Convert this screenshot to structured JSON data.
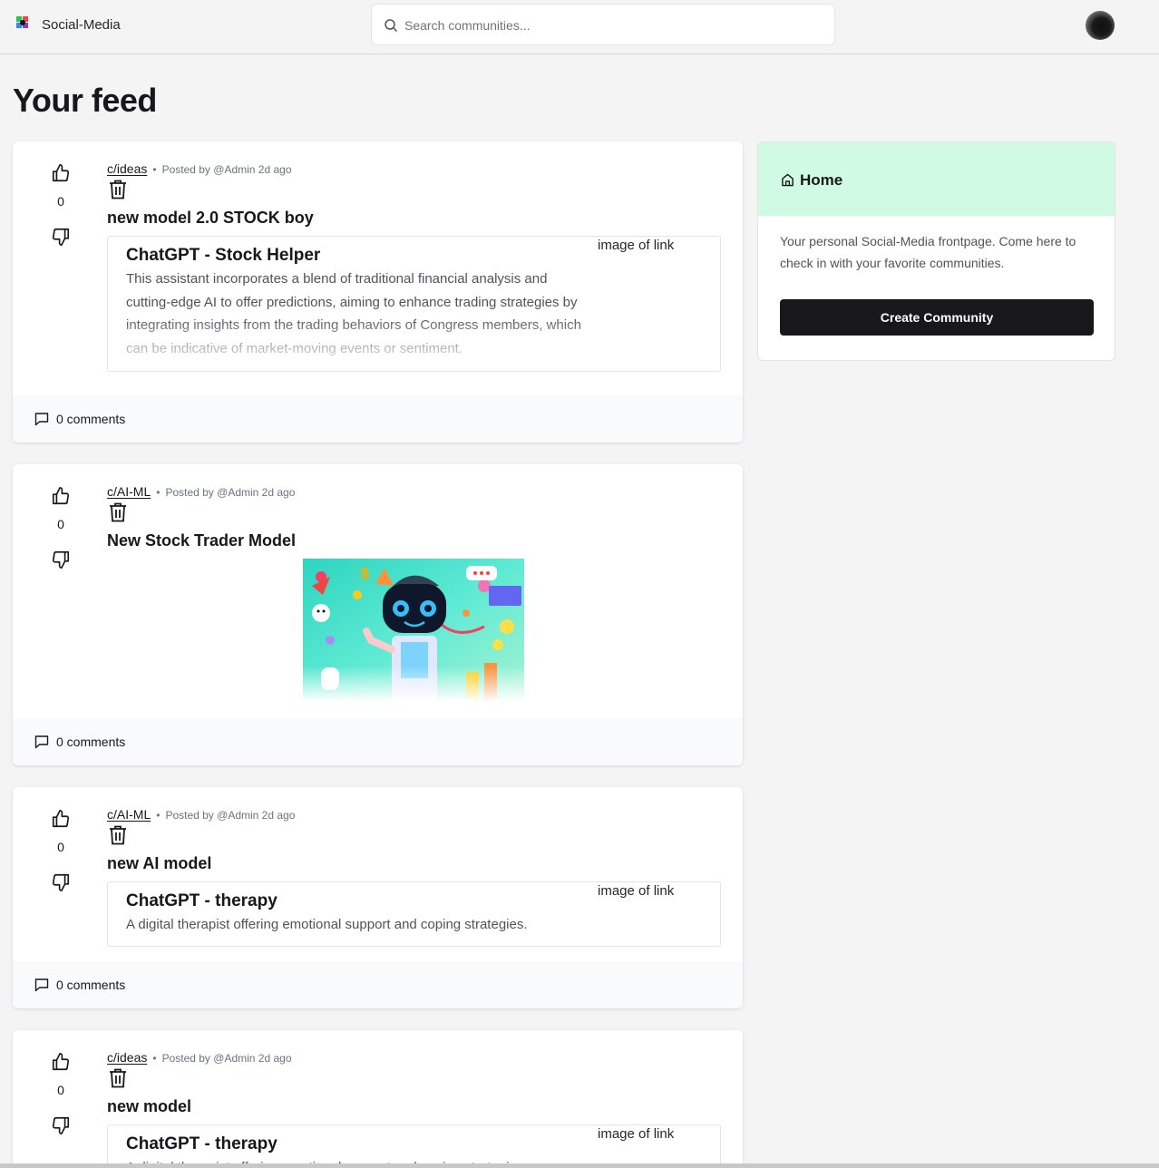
{
  "header": {
    "brand": "Social-Media",
    "search_placeholder": "Search communities..."
  },
  "page_title": "Your feed",
  "posts": [
    {
      "subreddit": "c/ideas",
      "posted_by": "Posted by @Admin 2d ago",
      "votes": "0",
      "title": "new model 2.0 STOCK boy",
      "link": {
        "title": "ChatGPT - Stock Helper",
        "description": "This assistant incorporates a blend of traditional financial analysis and cutting-edge AI to offer predictions, aiming to enhance trading strategies by integrating insights from the trading behaviors of Congress members, which can be indicative of market-moving events or sentiment.",
        "image_alt": "image of link"
      },
      "comments": "0 comments"
    },
    {
      "subreddit": "c/AI-ML",
      "posted_by": "Posted by @Admin 2d ago",
      "votes": "0",
      "title": "New Stock Trader Model",
      "comments": "0 comments"
    },
    {
      "subreddit": "c/AI-ML",
      "posted_by": "Posted by @Admin 2d ago",
      "votes": "0",
      "title": "new AI model",
      "link": {
        "title": "ChatGPT - therapy",
        "description": "A digital therapist offering emotional support and coping strategies.",
        "image_alt": "image of link"
      },
      "comments": "0 comments"
    },
    {
      "subreddit": "c/ideas",
      "posted_by": "Posted by @Admin 2d ago",
      "votes": "0",
      "title": "new model",
      "link": {
        "title": "ChatGPT - therapy",
        "description": "A digital therapist offering emotional support and coping strategies.",
        "image_alt": "image of link"
      }
    }
  ],
  "sidebar": {
    "title": "Home",
    "description": "Your personal Social-Media frontpage. Come here to check in with your favorite communities.",
    "create_button": "Create Community"
  },
  "icons": {
    "logo": "app-logo-icon",
    "search": "search-icon",
    "upvote": "thumbs-up-icon",
    "downvote": "thumbs-down-icon",
    "delete": "trash-icon",
    "comments": "message-square-icon",
    "home": "home-icon"
  },
  "colors": {
    "sidebar_header": "#d1fae5",
    "primary_button": "#18181b",
    "page_background": "#f4f4f5"
  }
}
